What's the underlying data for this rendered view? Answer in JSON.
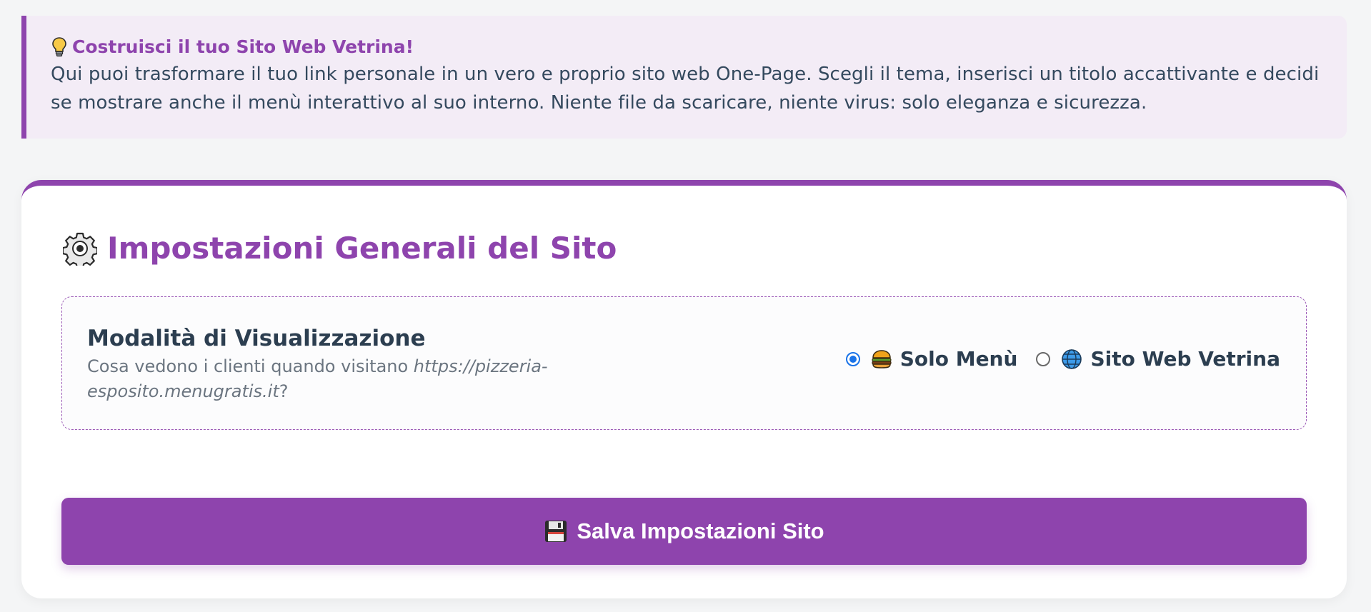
{
  "info": {
    "icon": "lightbulb-icon",
    "title": "Costruisci il tuo Sito Web Vetrina!",
    "text": "Qui puoi trasformare il tuo link personale in un vero e proprio sito web One-Page. Scegli il tema, inserisci un titolo accattivante e decidi se mostrare anche il menù interattivo al suo interno. Niente file da scaricare, niente virus: solo eleganza e sicurezza."
  },
  "settings": {
    "icon": "gear-icon",
    "title": "Impostazioni Generali del Sito",
    "display_mode": {
      "title": "Modalità di Visualizzazione",
      "desc_prefix": "Cosa vedono i clienti quando visitano ",
      "desc_url": "https://pizzeria-esposito.menugratis.it",
      "desc_suffix": "?",
      "options": [
        {
          "label": "Solo Menù",
          "icon": "burger-icon",
          "checked": true
        },
        {
          "label": "Sito Web Vetrina",
          "icon": "globe-icon",
          "checked": false
        }
      ]
    },
    "save_button": {
      "label": "Salva Impostazioni Sito",
      "icon": "floppy-disk-icon"
    }
  },
  "colors": {
    "accent": "#8e44ad",
    "banner_bg": "#f3ecf6",
    "text_dark": "#2c3e50",
    "radio_checked": "#1a73e8"
  }
}
